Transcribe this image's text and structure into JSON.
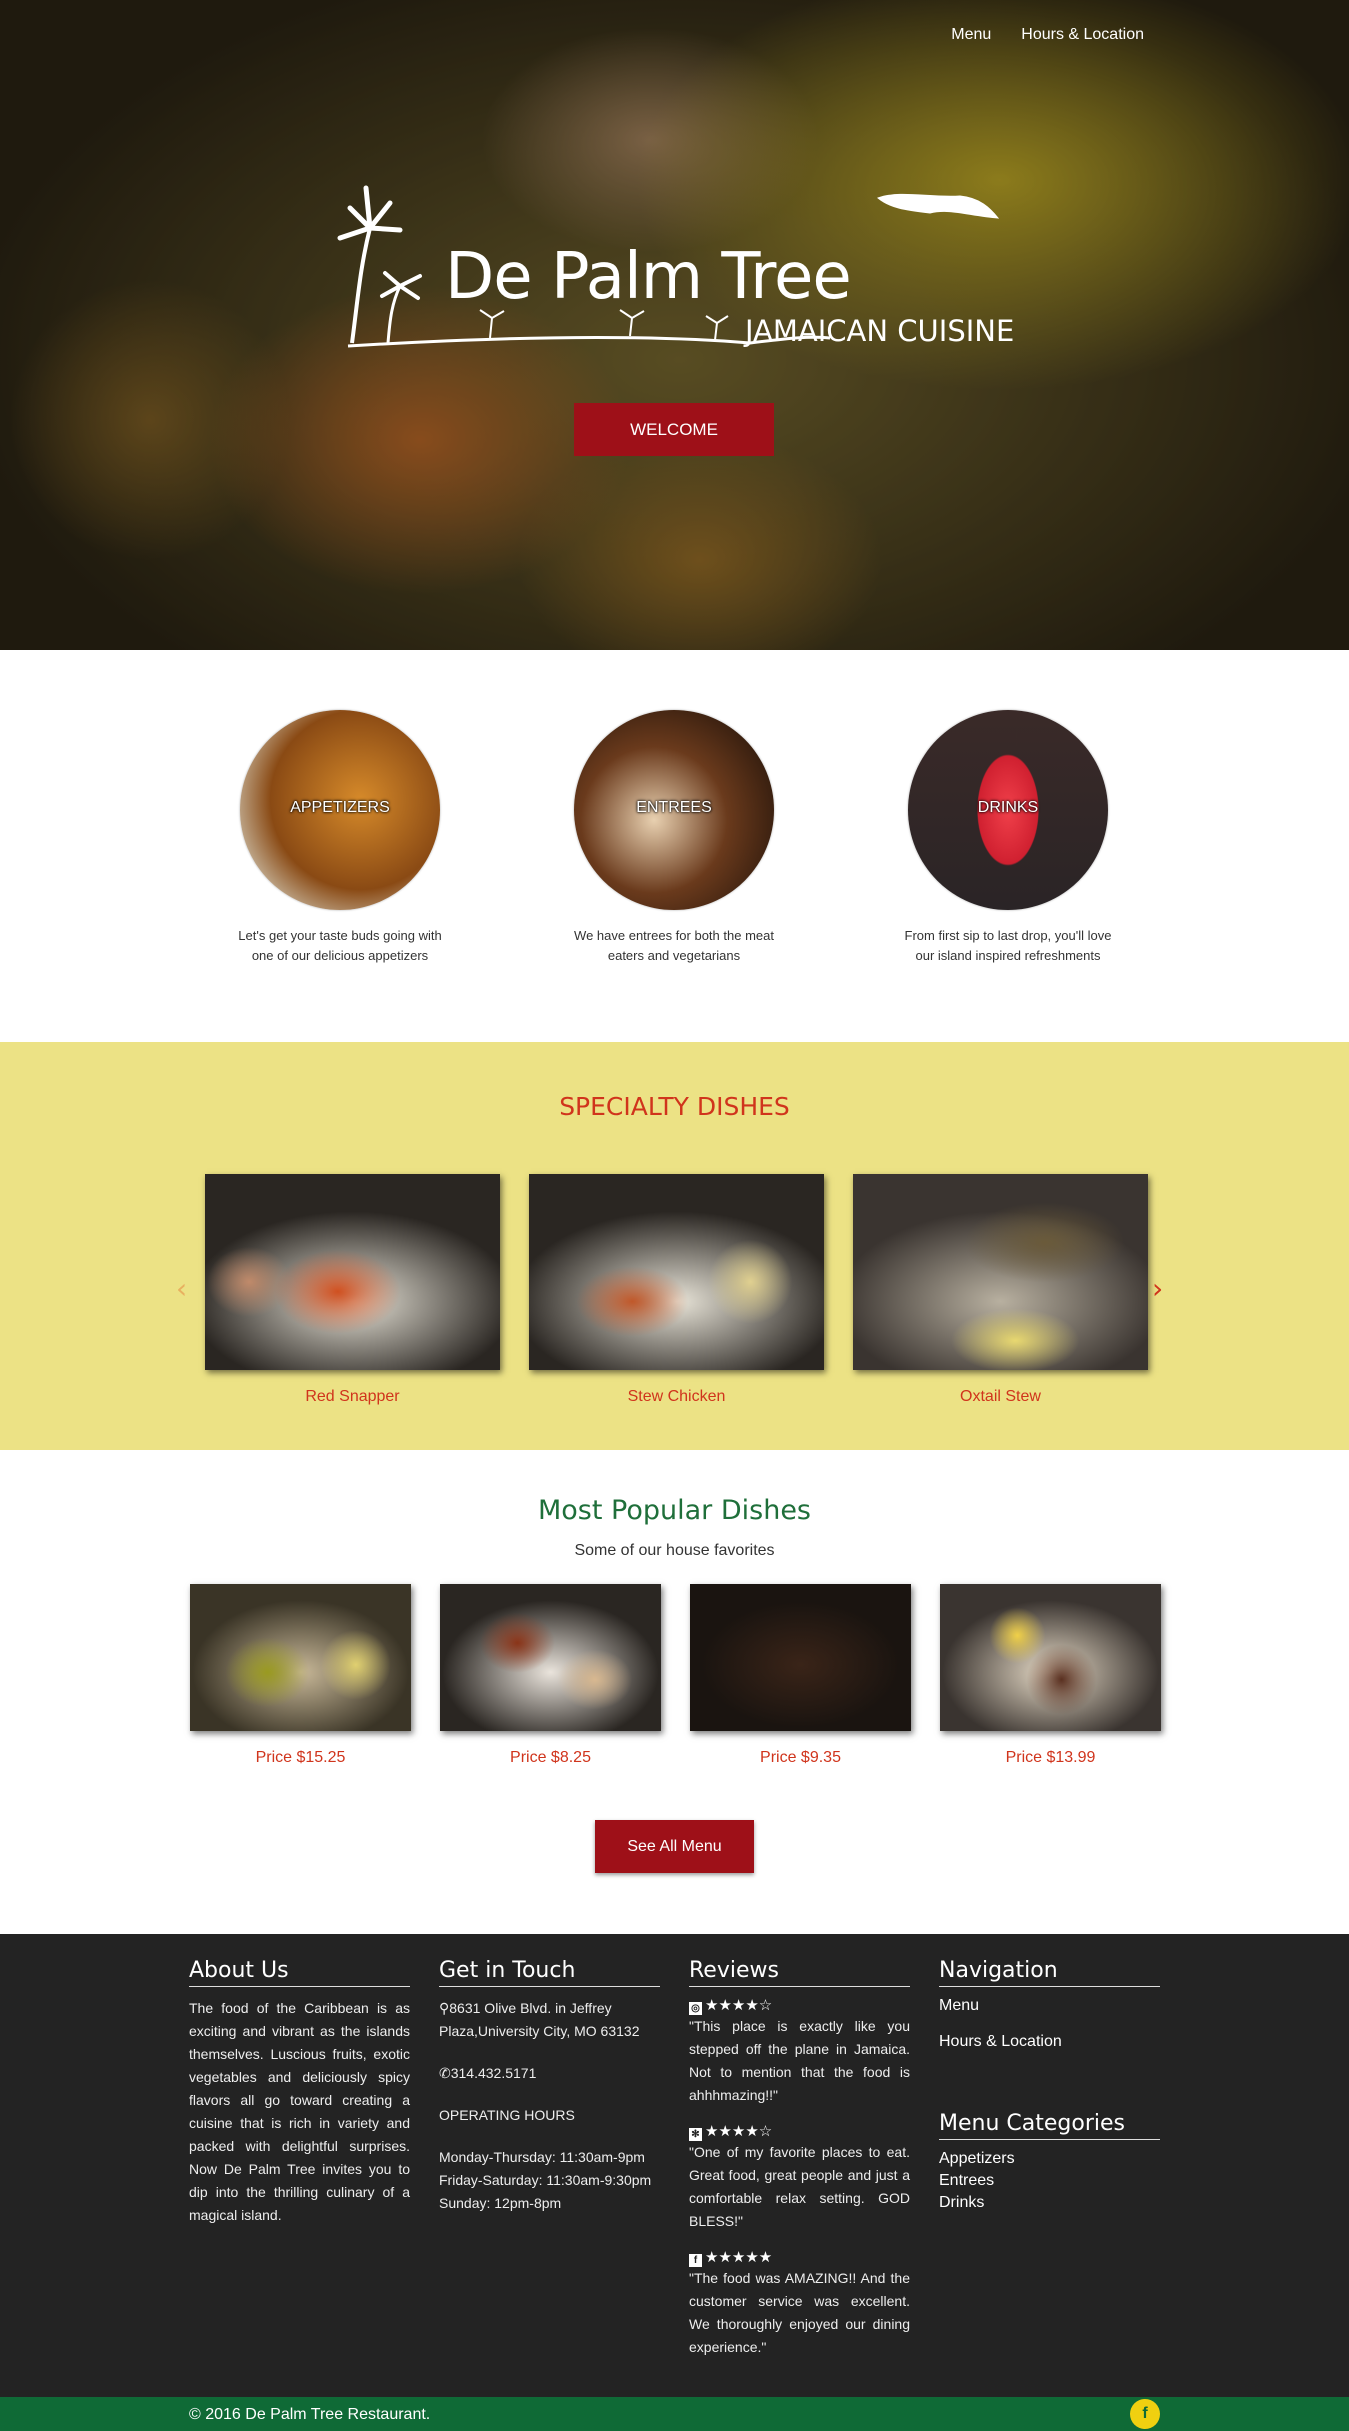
{
  "nav": {
    "menu": "Menu",
    "hours_location": "Hours & Location"
  },
  "hero": {
    "logo_name": "De Palm Tree",
    "logo_sub": "JAMAICAN CUISINE",
    "welcome_button": "WELCOME"
  },
  "categories": [
    {
      "label": "APPETIZERS",
      "desc": "Let's get your taste buds going with one of our delicious appetizers"
    },
    {
      "label": "ENTREES",
      "desc": "We have entrees for both the meat eaters and vegetarians"
    },
    {
      "label": "DRINKS",
      "desc": "From first sip to last drop, you'll love our island inspired refreshments"
    }
  ],
  "specialty": {
    "title": "SPECIALTY DISHES",
    "prev_icon": "chevron-left-icon",
    "next_icon": "chevron-right-icon",
    "items": [
      {
        "label": "Red Snapper"
      },
      {
        "label": "Stew Chicken"
      },
      {
        "label": "Oxtail Stew"
      }
    ]
  },
  "popular": {
    "title": "Most Popular Dishes",
    "subtitle": "Some of our house favorites",
    "items": [
      {
        "price": "Price $15.25"
      },
      {
        "price": "Price $8.25"
      },
      {
        "price": "Price $9.35"
      },
      {
        "price": "Price $13.99"
      }
    ],
    "see_all": "See All Menu"
  },
  "footer": {
    "about": {
      "title": "About Us",
      "text": "The food of the Caribbean is as exciting and vibrant as the islands themselves. Luscious fruits, exotic vegetables and deliciously spicy flavors all go toward creating a cuisine that is rich in variety and packed with delightful surprises. Now De Palm Tree invites you to dip into the thrilling culinary of a magical island."
    },
    "contact": {
      "title": "Get in Touch",
      "address": "8631 Olive Blvd. in Jeffrey Plaza,University City, MO 63132",
      "phone": "314.432.5171",
      "hours_title": "OPERATING HOURS",
      "hours": [
        "Monday-Thursday: 11:30am-9pm",
        "Friday-Saturday: 11:30am-9:30pm",
        "Sunday: 12pm-8pm"
      ]
    },
    "reviews": {
      "title": "Reviews",
      "items": [
        {
          "source_icon": "tripadvisor-icon",
          "source_glyph": "◎",
          "stars": "★★★★☆",
          "rating": 4,
          "text": "\"This place is exactly like you stepped off the plane in Jamaica. Not to mention that the food is ahhhmazing!!\""
        },
        {
          "source_icon": "yelp-icon",
          "source_glyph": "✻",
          "stars": "★★★★☆",
          "rating": 4,
          "text": "\"One of my favorite places to eat. Great food, great people and just a comfortable relax setting. GOD BLESS!\""
        },
        {
          "source_icon": "facebook-icon",
          "source_glyph": "f",
          "stars": "★★★★★",
          "rating": 5,
          "text": "\"The food was AMAZING!! And the customer service was excellent. We thoroughly enjoyed our dining experience.\""
        }
      ]
    },
    "navigation": {
      "title": "Navigation",
      "links": [
        "Menu",
        "Hours & Location"
      ],
      "categories_title": "Menu Categories",
      "categories": [
        "Appetizers",
        "Entrees",
        "Drinks"
      ]
    }
  },
  "bottom": {
    "copyright": "© 2016 De Palm Tree Restaurant.",
    "facebook_glyph": "f"
  },
  "colors": {
    "brand_red": "#9e1018",
    "accent_orange": "#d0341c",
    "specialty_bg": "#ece285",
    "footer_bg": "#232323",
    "green": "#0f6a36"
  }
}
